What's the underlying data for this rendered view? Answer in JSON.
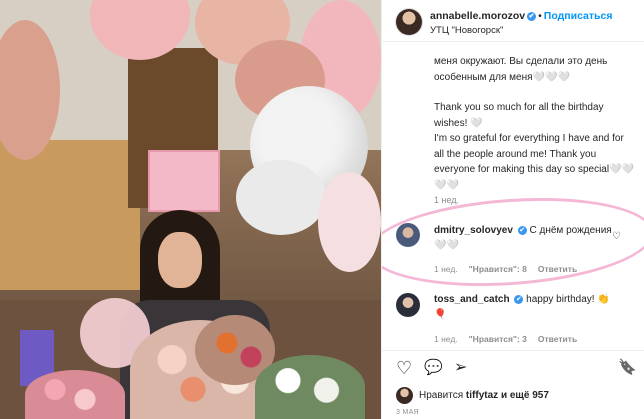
{
  "post": {
    "username": "annabelle.morozov",
    "verified_mark": "✔",
    "separator": "•",
    "follow_label": "Подписаться",
    "location": "УТЦ \"Новогорск\"",
    "caption": [
      "меня окружают. Вы сделали это день особенным для меня🤍🤍🤍",
      "Thank you so much for all the birthday wishes! 🤍\nI'm so grateful for everything I have and for all the people around me! Thank you everyone for making this day so special🤍🤍🤍🤍"
    ],
    "caption_time": "1 нед."
  },
  "comments": [
    {
      "username": "dmitry_solovyev",
      "verified_mark": "✔",
      "text": "С днём рождения🤍🤍",
      "time": "1 нед.",
      "likes": "\"Нравится\": 8",
      "reply": "Ответить",
      "heart": "♡"
    },
    {
      "username": "toss_and_catch",
      "verified_mark": "✔",
      "text": "happy birthday! 👏🎈",
      "time": "1 нед.",
      "likes": "\"Нравится\": 3",
      "reply": "Ответить"
    }
  ],
  "actions": {
    "like_icon": "♡",
    "comment_icon": "💬",
    "share_icon": "➢",
    "save_icon": "🔖"
  },
  "likes": {
    "prefix": "Нравится",
    "user": "tiffytaz",
    "suffix": "и ещё 957"
  },
  "date": "3 МАЯ",
  "colors": {
    "accent": "#0095f6",
    "text": "#262626",
    "muted": "#8e8e8e",
    "highlight": "#f0a0c8"
  }
}
